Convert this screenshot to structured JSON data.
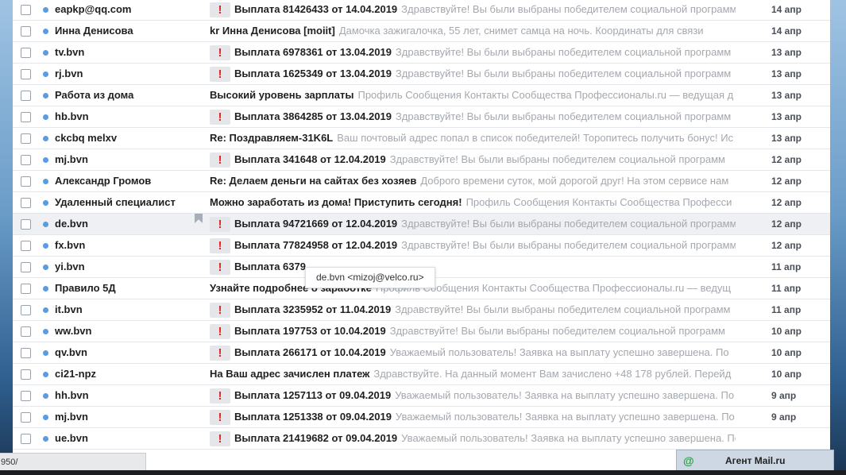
{
  "emails": [
    {
      "sender": "eapkp@qq.com",
      "flag": "!",
      "subject": "Выплата 81426433 от 14.04.2019",
      "snippet": "Здравствуйте! Вы были выбраны победителем социальной программ",
      "date": "14 апр"
    },
    {
      "sender": "Инна Денисова",
      "flag": "",
      "subject": "kr Инна Денисова [moiit]",
      "snippet": "Дамочка зажигалочка, 55 лет, снимет самца на ночь. Координаты для связи",
      "date": "14 апр"
    },
    {
      "sender": "tv.bvn",
      "flag": "!",
      "subject": "Выплата 6978361 от 13.04.2019",
      "snippet": "Здравствуйте! Вы были выбраны победителем социальной программ",
      "date": "13 апр"
    },
    {
      "sender": "rj.bvn",
      "flag": "!",
      "subject": "Выплата 1625349 от 13.04.2019",
      "snippet": "Здравствуйте! Вы были выбраны победителем социальной программ",
      "date": "13 апр"
    },
    {
      "sender": "Работа из дома",
      "flag": "",
      "subject": "Высокий уровень зарплаты",
      "snippet": "Профиль Сообщения Контакты Сообщества Профессионалы.ru — ведущая д",
      "date": "13 апр"
    },
    {
      "sender": "hb.bvn",
      "flag": "!",
      "subject": "Выплата 3864285 от 13.04.2019",
      "snippet": "Здравствуйте! Вы были выбраны победителем социальной программ",
      "date": "13 апр"
    },
    {
      "sender": "ckcbq melxv",
      "flag": "",
      "subject": "Re: Поздравляем-31K6L",
      "snippet": "Ваш почтовый адрес попал в список победителей! Торопитесь получить бонус! Ис",
      "date": "13 апр"
    },
    {
      "sender": "mj.bvn",
      "flag": "!",
      "subject": "Выплата 341648 от 12.04.2019",
      "snippet": "Здравствуйте! Вы были выбраны победителем социальной программ",
      "date": "12 апр"
    },
    {
      "sender": "Александр Громов",
      "flag": "",
      "subject": "Re: Делаем деньги на сайтах без хозяев",
      "snippet": "Доброго времени суток, мой дорогой друг! На этом сервисе нам",
      "date": "12 апр"
    },
    {
      "sender": "Удаленный специалист",
      "flag": "",
      "subject": "Можно заработать из дома! Приступить сегодня!",
      "snippet": "Профиль Сообщения Контакты Сообщества Професси",
      "date": "12 апр"
    },
    {
      "sender": "de.bvn",
      "flag": "!",
      "subject": "Выплата 94721669 от 12.04.2019",
      "snippet": "Здравствуйте! Вы были выбраны победителем социальной программ",
      "date": "12 апр"
    },
    {
      "sender": "fx.bvn",
      "flag": "!",
      "subject": "Выплата 77824958 от 12.04.2019",
      "snippet": "Здравствуйте! Вы были выбраны победителем социальной программ",
      "date": "12 апр"
    },
    {
      "sender": "yi.bvn",
      "flag": "!",
      "subject": "Выплата 6379",
      "snippet": "",
      "date": "11 апр"
    },
    {
      "sender": "Правило 5Д",
      "flag": "",
      "subject": "Узнайте подробнее о заработке",
      "snippet": "Профиль Сообщения Контакты Сообщества Профессионалы.ru — ведущ",
      "date": "11 апр"
    },
    {
      "sender": "it.bvn",
      "flag": "!",
      "subject": "Выплата 3235952 от 11.04.2019",
      "snippet": "Здравствуйте! Вы были выбраны победителем социальной программ",
      "date": "11 апр"
    },
    {
      "sender": "ww.bvn",
      "flag": "!",
      "subject": "Выплата 197753 от 10.04.2019",
      "snippet": "Здравствуйте! Вы были выбраны победителем социальной программ",
      "date": "10 апр"
    },
    {
      "sender": "qv.bvn",
      "flag": "!",
      "subject": "Выплата 266171 от 10.04.2019",
      "snippet": "Уважаемый пользователь! Заявка на выплату успешно завершена. По",
      "date": "10 апр"
    },
    {
      "sender": "ci21-npz",
      "flag": "",
      "subject": "На Ваш адрес зачислен платеж",
      "snippet": "Здравствуйте. На данный момент Вам зачислено +48 178 рублей. Перейд",
      "date": "10 апр"
    },
    {
      "sender": "hh.bvn",
      "flag": "!",
      "subject": "Выплата 1257113 от 09.04.2019",
      "snippet": "Уважаемый пользователь! Заявка на выплату успешно завершена. По",
      "date": "9 апр"
    },
    {
      "sender": "mj.bvn",
      "flag": "!",
      "subject": "Выплата 1251338 от 09.04.2019",
      "snippet": "Уважаемый пользователь! Заявка на выплату успешно завершена. По",
      "date": "9 апр"
    },
    {
      "sender": "ue.bvn",
      "flag": "!",
      "subject": "Выплата 21419682 от 09.04.2019",
      "snippet": "Уважаемый пользователь! Заявка на выплату успешно завершена. По",
      "date": ""
    }
  ],
  "hovered_row_index": 10,
  "tooltip": "de.bvn <mizoj@velco.ru>",
  "status_url": "950/",
  "agent": {
    "icon": "@",
    "label": "Агент Mail.ru"
  },
  "colors": {
    "flag_red": "#e8241e",
    "unread_dot": "#5b9be0",
    "snippet_gray": "#a4a8ae"
  }
}
